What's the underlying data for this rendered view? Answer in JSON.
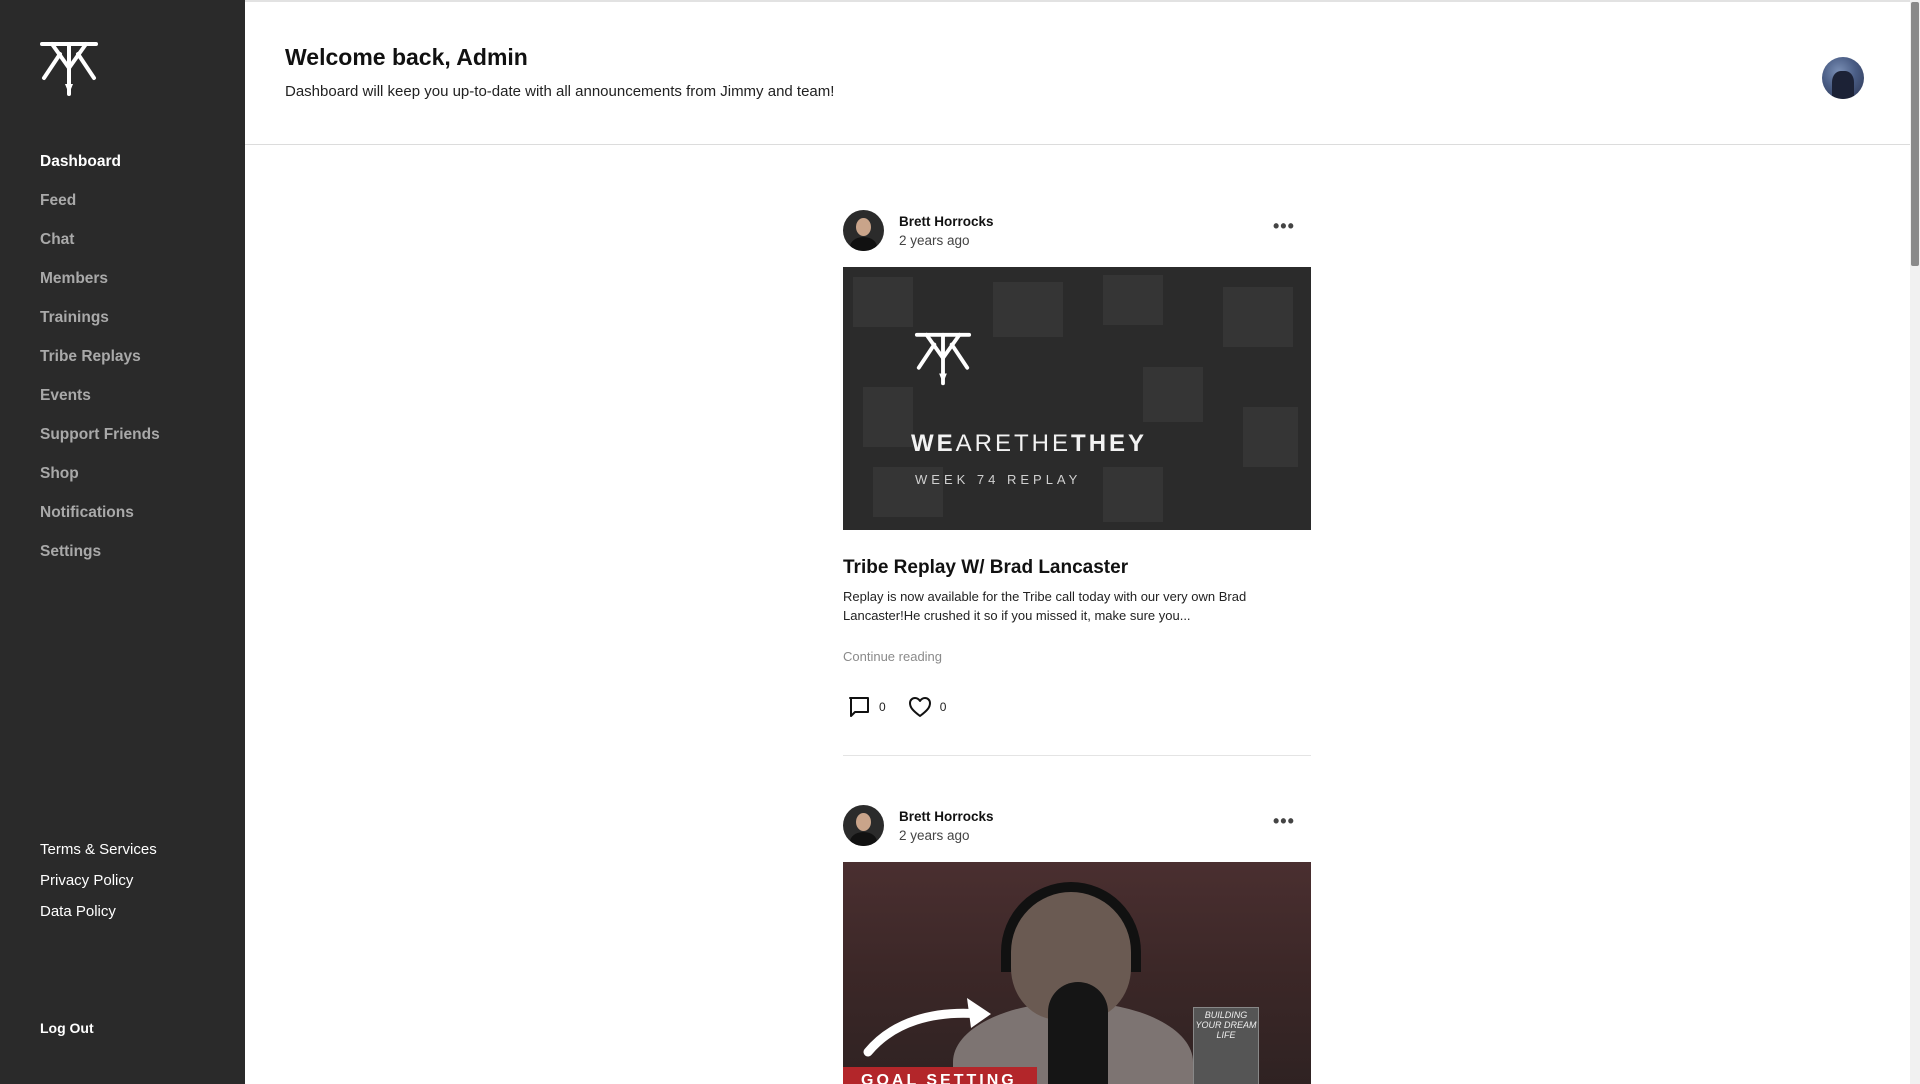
{
  "sidebar": {
    "logo_icon": "tribe-logo-icon",
    "nav": [
      {
        "label": "Dashboard",
        "active": true
      },
      {
        "label": "Feed"
      },
      {
        "label": "Chat"
      },
      {
        "label": "Members"
      },
      {
        "label": "Trainings"
      },
      {
        "label": "Tribe Replays"
      },
      {
        "label": "Events"
      },
      {
        "label": "Support Friends"
      },
      {
        "label": "Shop"
      },
      {
        "label": "Notifications"
      },
      {
        "label": "Settings"
      }
    ],
    "legal": [
      {
        "label": "Terms & Services"
      },
      {
        "label": "Privacy Policy"
      },
      {
        "label": "Data Policy"
      }
    ],
    "logout_label": "Log Out"
  },
  "header": {
    "title": "Welcome back, Admin",
    "subtitle": "Dashboard will keep you up-to-date with all announcements from Jimmy and team!"
  },
  "posts": [
    {
      "author": "Brett Horrocks",
      "time": "2 years ago",
      "image": {
        "brand_text_bold_1": "WE",
        "brand_text_light": "ARETHE",
        "brand_text_bold_2": "THEY",
        "sub_text": "WEEK 74 REPLAY"
      },
      "title": "Tribe Replay W/ Brad Lancaster",
      "excerpt": "Replay is now available for the Tribe call today with our very own Brad Lancaster!He crushed it so if you missed it, make sure you...",
      "continue_label": "Continue reading",
      "comments": "0",
      "likes": "0"
    },
    {
      "author": "Brett Horrocks",
      "time": "2 years ago",
      "image": {
        "banner_text": "GOAL SETTING",
        "book_text": "BUILDING YOUR DREAM LIFE"
      }
    }
  ],
  "colors": {
    "sidebar_bg": "#2a2a2a",
    "nav_active": "#ffffff",
    "nav_inactive": "#a9a9a9",
    "banner_red": "#b3262a"
  }
}
